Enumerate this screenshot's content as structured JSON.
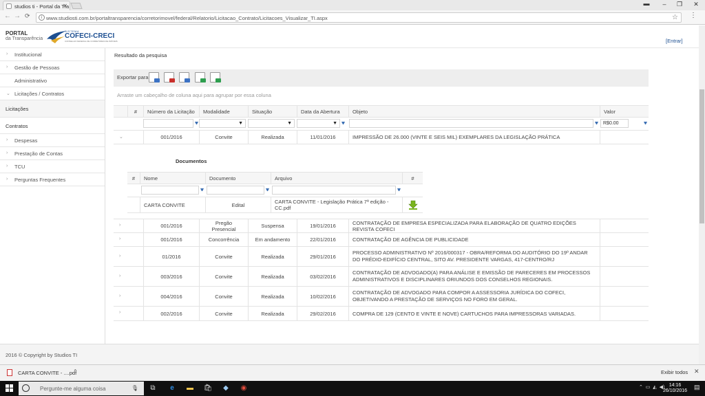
{
  "browser": {
    "tab_title": "studios ti - Portal da Tra",
    "url": "www.studiosti.com.br/portaltransparencia/corretorimovel/federal/Relatorio/Licitacao_Contrato/Licitacoes_Visualizar_TI.aspx",
    "back": "←",
    "forward": "→",
    "reload": "C",
    "menu_icon": "⋮",
    "star_icon": "☆"
  },
  "header": {
    "portal_title": "PORTAL",
    "portal_subtitle": "da Transparência",
    "logo_small": "SISTEMA",
    "logo_text": "COFECI-CRECI",
    "logo_tagline": "CONSELHO FEDERAL DE CORRETORES DE IMÓVEIS",
    "login": "[Entrar]"
  },
  "sidebar": {
    "items": [
      {
        "label": "Institucional",
        "chevron": "›"
      },
      {
        "label": "Gestão de Pessoas",
        "chevron": "›"
      },
      {
        "label": "Administrativo",
        "chevron": ""
      },
      {
        "label": "Licitações / Contratos",
        "chevron": "⌄"
      },
      {
        "label": "Licitações",
        "chevron": ""
      },
      {
        "label": "Contratos",
        "chevron": ""
      },
      {
        "label": "Despesas",
        "chevron": "›"
      },
      {
        "label": "Prestação de Contas",
        "chevron": "›"
      },
      {
        "label": "TCU",
        "chevron": "›"
      },
      {
        "label": "Perguntas Frequentes",
        "chevron": "›"
      }
    ]
  },
  "main": {
    "result_title": "Resultado da pesquisa",
    "export_label": "Exportar para:",
    "group_hint": "Arraste um cabeçalho de coluna aqui para agrupar por essa coluna",
    "columns": [
      "#",
      "Número da Licitação",
      "Modalidade",
      "Situação",
      "Data da Abertura",
      "Objeto",
      "Valor"
    ],
    "valor_filter": "R$0.00",
    "expanded_row": {
      "numero": "001/2016",
      "modalidade": "Convite",
      "situacao": "Realizada",
      "data": "11/01/2016",
      "objeto": "IMPRESSÃO DE 26.000 (VINTE E SEIS MIL) EXEMPLARES DA LEGISLAÇÃO PRÁTICA"
    },
    "documents": {
      "title": "Documentos",
      "columns": [
        "#",
        "Nome",
        "Documento",
        "Arquivo",
        "#"
      ],
      "rows": [
        {
          "nome": "CARTA CONVITE",
          "documento": "Edital",
          "arquivo": "CARTA CONVITE - Legislação Prática 7ª edição - CC.pdf"
        }
      ]
    },
    "rows": [
      {
        "numero": "001/2016",
        "modalidade": "Pregão Presencial",
        "situacao": "Suspensa",
        "data": "19/01/2016",
        "objeto": "CONTRATAÇÃO DE EMPRESA ESPECIALIZADA PARA ELABORAÇÃO DE QUATRO EDIÇÕES REVISTA COFECI"
      },
      {
        "numero": "001/2016",
        "modalidade": "Concorrência",
        "situacao": "Em andamento",
        "data": "22/01/2016",
        "objeto": "CONTRATAÇÃO DE AGÊNCIA DE PUBLICIDADE"
      },
      {
        "numero": "01/2016",
        "modalidade": "Convite",
        "situacao": "Realizada",
        "data": "29/01/2016",
        "objeto": "PROCESSO ADMINISTRATIVO Nº 2016/000317 - OBRA/REFORMA DO AUDITÓRIO DO 19º ANDAR DO PRÉDIO-EDIFÍCIO CENTRAL, SITO AV. PRESIDENTE VARGAS, 417-CENTRO/RJ"
      },
      {
        "numero": "003/2016",
        "modalidade": "Convite",
        "situacao": "Realizada",
        "data": "03/02/2016",
        "objeto": "CONTRATAÇÃO DE ADVOGADO(A) PARA ANÁLISE E EMISSÃO DE PARECERES EM PROCESSOS ADMINISTRATIVOS E DISCIPLINARES ORIUNDOS DOS CONSELHOS REGIONAIS."
      },
      {
        "numero": "004/2016",
        "modalidade": "Convite",
        "situacao": "Realizada",
        "data": "10/02/2016",
        "objeto": "CONTRATAÇÃO DE ADVOGADO PARA COMPOR A ASSESSORIA JURÍDICA DO COFECI, OBJETIVANDO A PRESTAÇÃO DE SERVIÇOS NO FORO EM GERAL."
      },
      {
        "numero": "002/2016",
        "modalidade": "Convite",
        "situacao": "Realizada",
        "data": "29/02/2016",
        "objeto": "COMPRA DE 129 (CENTO E VINTE E NOVE) CARTUCHOS PARA IMPRESSORAS VARIADAS."
      }
    ]
  },
  "footer": {
    "copyright": "2016 © Copyright by Studios TI"
  },
  "downloads": {
    "file": "CARTA CONVITE - ....pdf",
    "show_all": "Exibir todos",
    "close": "✕"
  },
  "taskbar": {
    "search_placeholder": "Pergunte-me alguma coisa",
    "time": "14:16",
    "date": "26/10/2016"
  }
}
